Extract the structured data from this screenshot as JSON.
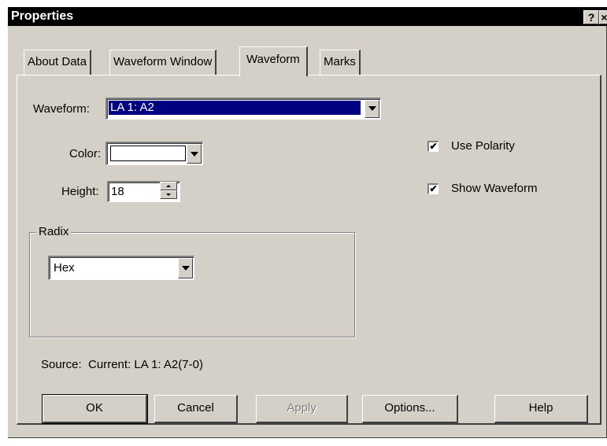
{
  "window": {
    "title": "Properties",
    "help_button": "?",
    "close_button": "×"
  },
  "tabs": [
    {
      "label": "About Data",
      "active": false
    },
    {
      "label": "Waveform Window",
      "active": false
    },
    {
      "label": "Waveform",
      "active": true
    },
    {
      "label": "Marks",
      "active": false
    }
  ],
  "waveform": {
    "label": "Waveform:",
    "value": "LA 1: A2"
  },
  "color": {
    "label": "Color:",
    "value": "#ffffff"
  },
  "height": {
    "label": "Height:",
    "value": "18"
  },
  "radix": {
    "group_label": "Radix",
    "value": "Hex"
  },
  "options": {
    "use_polarity": {
      "label": "Use Polarity",
      "checked": true
    },
    "show_waveform": {
      "label": "Show Waveform",
      "checked": true
    }
  },
  "source_text": "Source:  Current: LA 1: A2(7-0)",
  "buttons": {
    "ok": "OK",
    "cancel": "Cancel",
    "apply": "Apply",
    "options": "Options...",
    "help": "Help"
  }
}
